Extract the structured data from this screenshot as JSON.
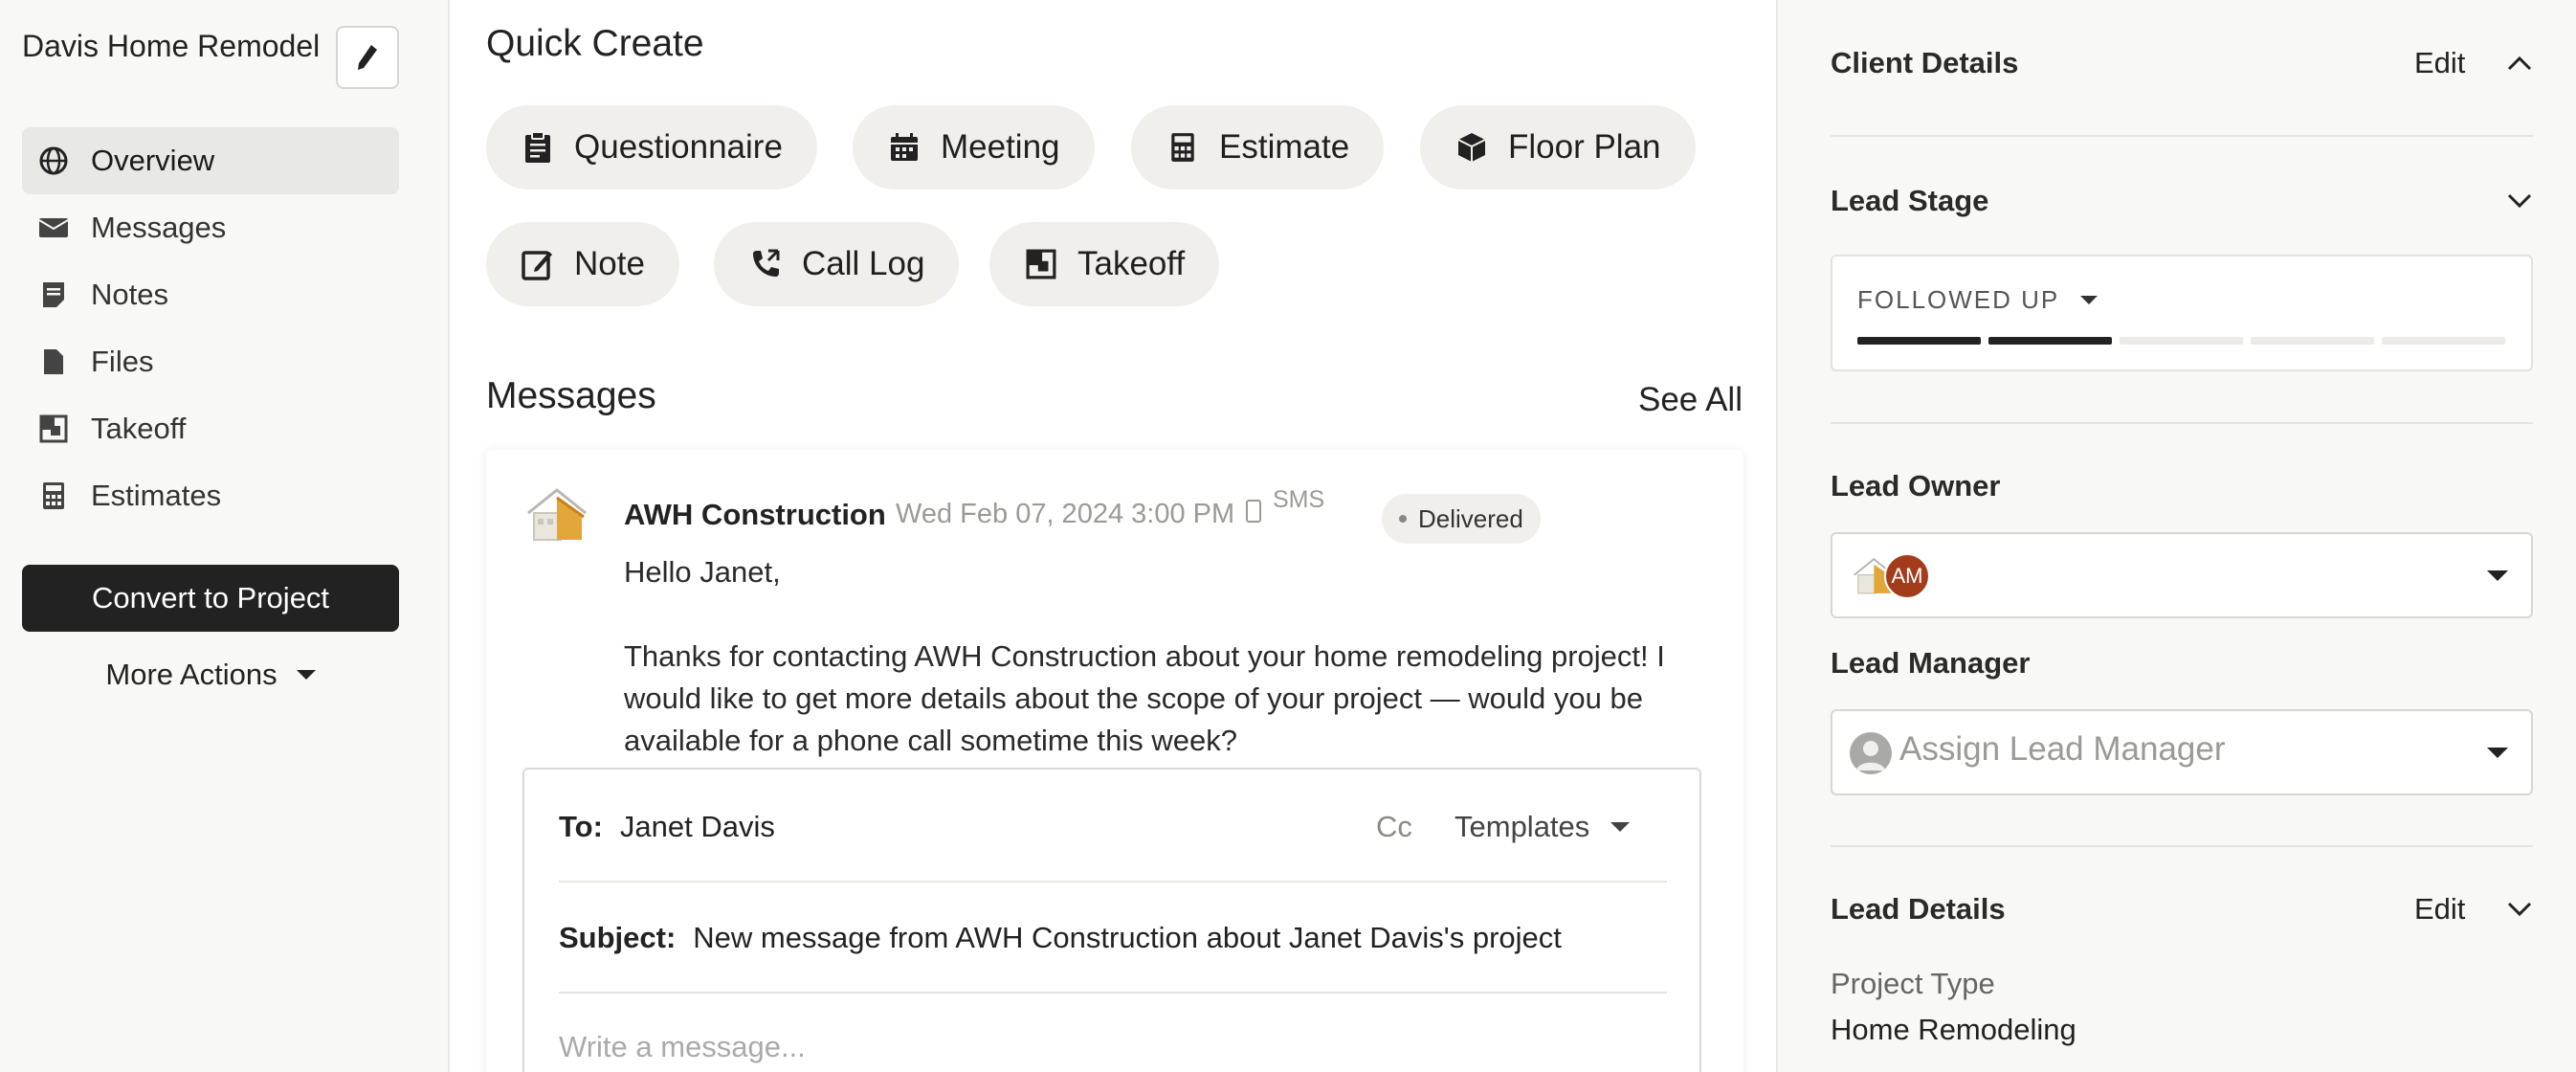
{
  "sidebar": {
    "project_title": "Davis Home Remodel",
    "nav": [
      {
        "label": "Overview",
        "icon": "globe-icon",
        "active": true
      },
      {
        "label": "Messages",
        "icon": "envelope-icon",
        "active": false
      },
      {
        "label": "Notes",
        "icon": "note-icon",
        "active": false
      },
      {
        "label": "Files",
        "icon": "file-icon",
        "active": false
      },
      {
        "label": "Takeoff",
        "icon": "takeoff-icon",
        "active": false
      },
      {
        "label": "Estimates",
        "icon": "calculator-icon",
        "active": false
      }
    ],
    "convert_label": "Convert to Project",
    "more_actions_label": "More Actions"
  },
  "main": {
    "quick_create_title": "Quick Create",
    "quick_create": [
      {
        "label": "Questionnaire",
        "icon": "clipboard-icon"
      },
      {
        "label": "Meeting",
        "icon": "calendar-icon"
      },
      {
        "label": "Estimate",
        "icon": "calculator-icon"
      },
      {
        "label": "Floor Plan",
        "icon": "cube-icon"
      },
      {
        "label": "Note",
        "icon": "edit-note-icon"
      },
      {
        "label": "Call Log",
        "icon": "phone-icon"
      },
      {
        "label": "Takeoff",
        "icon": "takeoff-icon"
      }
    ],
    "messages_title": "Messages",
    "see_all_label": "See All",
    "message": {
      "sender": "AWH Construction",
      "date": "Wed Feb 07, 2024 3:00 PM",
      "channel": "SMS",
      "status": "Delivered",
      "greeting": "Hello Janet,",
      "body": "Thanks for contacting AWH Construction about your home remodeling project! I would like to get more details about the scope of your project — would you be available for a phone call sometime this week?"
    },
    "composer": {
      "to_label": "To:",
      "to_value": "Janet Davis",
      "cc_label": "Cc",
      "templates_label": "Templates",
      "subject_label": "Subject:",
      "subject_value": "New message from AWH Construction about Janet Davis's project",
      "placeholder": "Write a message..."
    }
  },
  "right": {
    "client_details_title": "Client Details",
    "client_edit_label": "Edit",
    "lead_stage_title": "Lead Stage",
    "lead_stage_value": "FOLLOWED UP",
    "lead_stage_progress": {
      "completed": 2,
      "total": 5
    },
    "lead_owner_title": "Lead Owner",
    "lead_owner_initials": "AM",
    "lead_manager_title": "Lead Manager",
    "lead_manager_placeholder": "Assign Lead Manager",
    "lead_details_title": "Lead Details",
    "lead_details_edit_label": "Edit",
    "project_type_label": "Project Type",
    "project_type_value": "Home Remodeling"
  },
  "colors": {
    "accent_dark": "#222222",
    "chip_bg": "#f0efeb",
    "owner_badge": "#a23c1a",
    "sidebar_bg": "#f8f8f6"
  }
}
